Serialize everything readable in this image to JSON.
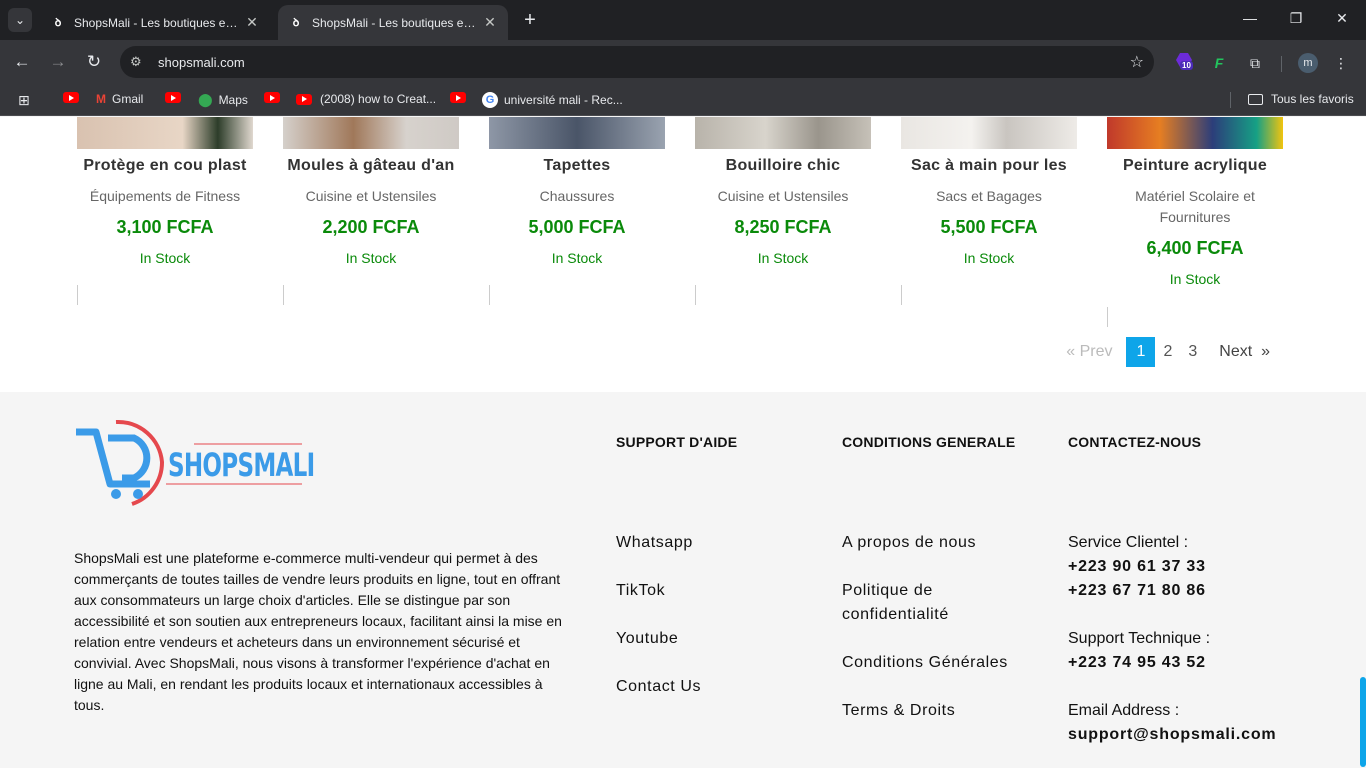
{
  "browser": {
    "tabs": [
      {
        "title": "ShopsMali - Les boutiques en ligne"
      },
      {
        "title": "ShopsMali - Les boutiques en ligne"
      }
    ],
    "url": "shopsmali.com",
    "bookmarks": [
      {
        "label": "",
        "icon": "youtube-icon"
      },
      {
        "label": "Gmail",
        "icon": "gmail-icon"
      },
      {
        "label": "",
        "icon": "youtube-icon"
      },
      {
        "label": "Maps",
        "icon": "maps-icon"
      },
      {
        "label": "",
        "icon": "youtube-icon"
      },
      {
        "label": "(2008) how to Creat...",
        "icon": "youtube-icon"
      },
      {
        "label": "",
        "icon": "youtube-icon"
      },
      {
        "label": "université mali - Rec...",
        "icon": "google-icon"
      }
    ],
    "all_bookmarks": "Tous les favoris",
    "extension_badge": "10",
    "profile_initial": "m"
  },
  "products": [
    {
      "name": "Protège en cou plast",
      "category": "Équipements de Fitness",
      "price": "3,100 FCFA",
      "stock": "In Stock"
    },
    {
      "name": "Moules à gâteau d'an",
      "category": "Cuisine et Ustensiles",
      "price": "2,200 FCFA",
      "stock": "In Stock"
    },
    {
      "name": "Tapettes",
      "category": "Chaussures",
      "price": "5,000 FCFA",
      "stock": "In Stock"
    },
    {
      "name": "Bouilloire chic",
      "category": "Cuisine et Ustensiles",
      "price": "8,250 FCFA",
      "stock": "In Stock"
    },
    {
      "name": "Sac à main pour les",
      "category": "Sacs et Bagages",
      "price": "5,500 FCFA",
      "stock": "In Stock"
    },
    {
      "name": "Peinture acrylique",
      "category": "Matériel Scolaire et Fournitures",
      "price": "6,400 FCFA",
      "stock": "In Stock"
    }
  ],
  "pagination": {
    "prev": "Prev",
    "pages": [
      "1",
      "2",
      "3"
    ],
    "current": "1",
    "next": "Next"
  },
  "footer": {
    "logo_text": "SHOPSMALI",
    "about": "ShopsMali est une plateforme e-commerce multi-vendeur qui permet à des commerçants de toutes tailles de vendre leurs produits en ligne, tout en offrant aux consommateurs un large choix d'articles. Elle se distingue par son accessibilité et son soutien aux entrepreneurs locaux, facilitant ainsi la mise en relation entre vendeurs et acheteurs dans un environnement sécurisé et convivial. Avec ShopsMali, nous visons à transformer l'expérience d'achat en ligne au Mali, en rendant les produits locaux et internationaux accessibles à tous.",
    "support": {
      "heading": "SUPPORT D'AIDE",
      "links": [
        "Whatsapp",
        "TikTok",
        "Youtube",
        "Contact Us"
      ]
    },
    "conditions": {
      "heading": "CONDITIONS GENERALE",
      "links": [
        "A propos de nous",
        "Politique de confidentialité",
        "Conditions Générales",
        "Terms & Droits"
      ]
    },
    "contact": {
      "heading": "CONTACTEZ-NOUS",
      "service_label": "Service Clientel :",
      "service_phone_1": "+223 90 61 37 33",
      "service_phone_2": "+223 67 71 80 86",
      "tech_label": "Support Technique :",
      "tech_phone": "+223 74 95 43 52",
      "email_label": "Email Address :",
      "email": "support@shopsmali.com"
    }
  },
  "colors": {
    "accent": "#0ea5e9",
    "price_green": "#0a8a0a",
    "logo_blue": "#3b9be8",
    "logo_red": "#e5484d"
  }
}
